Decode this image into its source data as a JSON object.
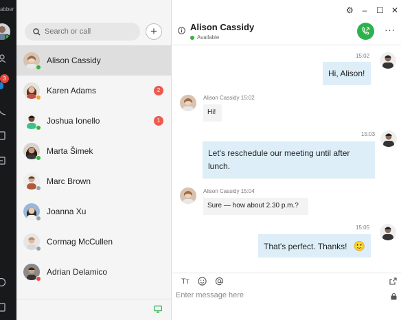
{
  "rail": {
    "brand": "abber",
    "unread_badge": "3"
  },
  "list": {
    "search": {
      "placeholder": "Search or call"
    },
    "add_label": "+",
    "contacts": [
      {
        "name": "Alison Cassidy",
        "status": "available",
        "unread": ""
      },
      {
        "name": "Karen Adams",
        "status": "away",
        "unread": "2"
      },
      {
        "name": "Joshua Ionello",
        "status": "available",
        "unread": "1"
      },
      {
        "name": "Marta Šimek",
        "status": "available",
        "unread": ""
      },
      {
        "name": "Marc Brown",
        "status": "offline",
        "unread": ""
      },
      {
        "name": "Joanna Xu",
        "status": "offline",
        "unread": ""
      },
      {
        "name": "Cormag McCullen",
        "status": "offline",
        "unread": ""
      },
      {
        "name": "Adrian Delamico",
        "status": "busy",
        "unread": ""
      }
    ]
  },
  "conversation": {
    "title": "Alison Cassidy",
    "presence": "Available",
    "messages": [
      {
        "dir": "out",
        "time": "15:02",
        "text": "Hi, Alison!"
      },
      {
        "dir": "in",
        "meta": "Alison Cassidy 15:02",
        "text": "Hi!"
      },
      {
        "dir": "out",
        "time": "15:03",
        "text": "Let's reschedule our meeting until after lunch."
      },
      {
        "dir": "in",
        "meta": "Alison Cassidy 15:04",
        "text": "Sure — how about 2.30 p.m.?"
      },
      {
        "dir": "out",
        "time": "15:05",
        "text": "That's perfect. Thanks!",
        "emoji": "🙂"
      }
    ],
    "composer": {
      "placeholder": "Enter message here",
      "format_label": "Tт"
    }
  },
  "colors": {
    "rail_bg": "#17191b",
    "available": "#2fb53d",
    "badge": "#ef5a4f",
    "call_button": "#2cb24a",
    "outgoing_bubble": "#ddeef8",
    "selected_row": "#dedede"
  },
  "icons": {
    "window": [
      "settings-icon",
      "minimize-icon",
      "maximize-icon",
      "close-icon"
    ],
    "composer": [
      "text-format-icon",
      "emoji-icon",
      "mention-icon",
      "expand-icon",
      "lock-icon"
    ]
  }
}
